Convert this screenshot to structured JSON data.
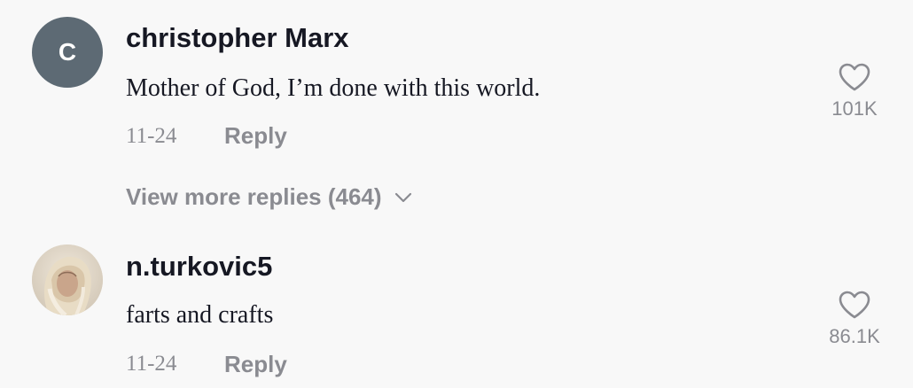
{
  "comments": [
    {
      "avatar_letter": "C",
      "avatar_color": "#5d6a74",
      "username": "christopher Marx",
      "text": "Mother of God, I’m done with this world.",
      "date": "11-24",
      "reply_label": "Reply",
      "likes": "101K",
      "like_icon": "heart-outline-icon"
    },
    {
      "avatar_image": "user-photo",
      "username": "n.turkovic5",
      "text": "farts and crafts",
      "date": "11-24",
      "reply_label": "Reply",
      "likes": "86.1K",
      "like_icon": "heart-outline-icon"
    }
  ],
  "view_more_replies": {
    "label": "View more replies (464)",
    "icon": "chevron-down-icon"
  },
  "colors": {
    "background": "#f8f8f8",
    "primary_text": "#161823",
    "secondary_text": "#8a8b91"
  }
}
